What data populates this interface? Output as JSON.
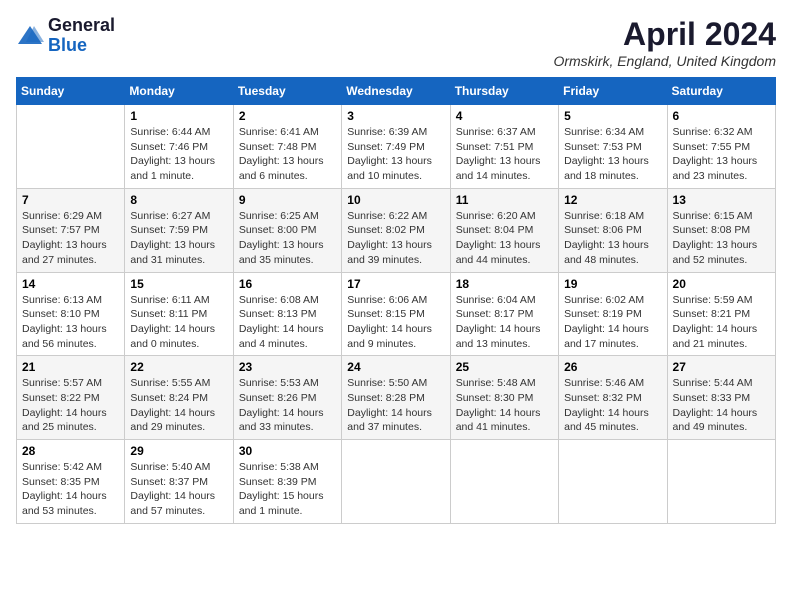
{
  "header": {
    "logo": {
      "line1": "General",
      "line2": "Blue"
    },
    "title": "April 2024",
    "location": "Ormskirk, England, United Kingdom"
  },
  "weekdays": [
    "Sunday",
    "Monday",
    "Tuesday",
    "Wednesday",
    "Thursday",
    "Friday",
    "Saturday"
  ],
  "weeks": [
    [
      {
        "day": "",
        "info": ""
      },
      {
        "day": "1",
        "info": "Sunrise: 6:44 AM\nSunset: 7:46 PM\nDaylight: 13 hours\nand 1 minute."
      },
      {
        "day": "2",
        "info": "Sunrise: 6:41 AM\nSunset: 7:48 PM\nDaylight: 13 hours\nand 6 minutes."
      },
      {
        "day": "3",
        "info": "Sunrise: 6:39 AM\nSunset: 7:49 PM\nDaylight: 13 hours\nand 10 minutes."
      },
      {
        "day": "4",
        "info": "Sunrise: 6:37 AM\nSunset: 7:51 PM\nDaylight: 13 hours\nand 14 minutes."
      },
      {
        "day": "5",
        "info": "Sunrise: 6:34 AM\nSunset: 7:53 PM\nDaylight: 13 hours\nand 18 minutes."
      },
      {
        "day": "6",
        "info": "Sunrise: 6:32 AM\nSunset: 7:55 PM\nDaylight: 13 hours\nand 23 minutes."
      }
    ],
    [
      {
        "day": "7",
        "info": "Sunrise: 6:29 AM\nSunset: 7:57 PM\nDaylight: 13 hours\nand 27 minutes."
      },
      {
        "day": "8",
        "info": "Sunrise: 6:27 AM\nSunset: 7:59 PM\nDaylight: 13 hours\nand 31 minutes."
      },
      {
        "day": "9",
        "info": "Sunrise: 6:25 AM\nSunset: 8:00 PM\nDaylight: 13 hours\nand 35 minutes."
      },
      {
        "day": "10",
        "info": "Sunrise: 6:22 AM\nSunset: 8:02 PM\nDaylight: 13 hours\nand 39 minutes."
      },
      {
        "day": "11",
        "info": "Sunrise: 6:20 AM\nSunset: 8:04 PM\nDaylight: 13 hours\nand 44 minutes."
      },
      {
        "day": "12",
        "info": "Sunrise: 6:18 AM\nSunset: 8:06 PM\nDaylight: 13 hours\nand 48 minutes."
      },
      {
        "day": "13",
        "info": "Sunrise: 6:15 AM\nSunset: 8:08 PM\nDaylight: 13 hours\nand 52 minutes."
      }
    ],
    [
      {
        "day": "14",
        "info": "Sunrise: 6:13 AM\nSunset: 8:10 PM\nDaylight: 13 hours\nand 56 minutes."
      },
      {
        "day": "15",
        "info": "Sunrise: 6:11 AM\nSunset: 8:11 PM\nDaylight: 14 hours\nand 0 minutes."
      },
      {
        "day": "16",
        "info": "Sunrise: 6:08 AM\nSunset: 8:13 PM\nDaylight: 14 hours\nand 4 minutes."
      },
      {
        "day": "17",
        "info": "Sunrise: 6:06 AM\nSunset: 8:15 PM\nDaylight: 14 hours\nand 9 minutes."
      },
      {
        "day": "18",
        "info": "Sunrise: 6:04 AM\nSunset: 8:17 PM\nDaylight: 14 hours\nand 13 minutes."
      },
      {
        "day": "19",
        "info": "Sunrise: 6:02 AM\nSunset: 8:19 PM\nDaylight: 14 hours\nand 17 minutes."
      },
      {
        "day": "20",
        "info": "Sunrise: 5:59 AM\nSunset: 8:21 PM\nDaylight: 14 hours\nand 21 minutes."
      }
    ],
    [
      {
        "day": "21",
        "info": "Sunrise: 5:57 AM\nSunset: 8:22 PM\nDaylight: 14 hours\nand 25 minutes."
      },
      {
        "day": "22",
        "info": "Sunrise: 5:55 AM\nSunset: 8:24 PM\nDaylight: 14 hours\nand 29 minutes."
      },
      {
        "day": "23",
        "info": "Sunrise: 5:53 AM\nSunset: 8:26 PM\nDaylight: 14 hours\nand 33 minutes."
      },
      {
        "day": "24",
        "info": "Sunrise: 5:50 AM\nSunset: 8:28 PM\nDaylight: 14 hours\nand 37 minutes."
      },
      {
        "day": "25",
        "info": "Sunrise: 5:48 AM\nSunset: 8:30 PM\nDaylight: 14 hours\nand 41 minutes."
      },
      {
        "day": "26",
        "info": "Sunrise: 5:46 AM\nSunset: 8:32 PM\nDaylight: 14 hours\nand 45 minutes."
      },
      {
        "day": "27",
        "info": "Sunrise: 5:44 AM\nSunset: 8:33 PM\nDaylight: 14 hours\nand 49 minutes."
      }
    ],
    [
      {
        "day": "28",
        "info": "Sunrise: 5:42 AM\nSunset: 8:35 PM\nDaylight: 14 hours\nand 53 minutes."
      },
      {
        "day": "29",
        "info": "Sunrise: 5:40 AM\nSunset: 8:37 PM\nDaylight: 14 hours\nand 57 minutes."
      },
      {
        "day": "30",
        "info": "Sunrise: 5:38 AM\nSunset: 8:39 PM\nDaylight: 15 hours\nand 1 minute."
      },
      {
        "day": "",
        "info": ""
      },
      {
        "day": "",
        "info": ""
      },
      {
        "day": "",
        "info": ""
      },
      {
        "day": "",
        "info": ""
      }
    ]
  ]
}
